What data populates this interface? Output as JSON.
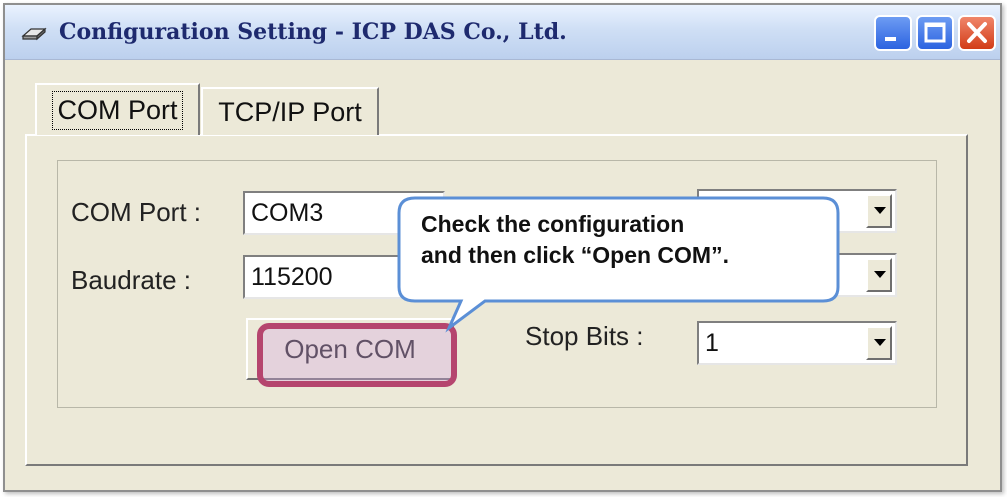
{
  "window": {
    "title": "Configuration Setting - ICP DAS Co., Ltd."
  },
  "tabs": [
    {
      "label": "COM Port",
      "selected": true
    },
    {
      "label": "TCP/IP Port",
      "selected": false
    }
  ],
  "form": {
    "com_port_label": "COM Port :",
    "com_port_value": "COM3",
    "baudrate_label": "Baudrate :",
    "baudrate_value": "115200",
    "stop_bits_label": "Stop Bits :",
    "stop_bits_value": "1",
    "open_button_label": "Open COM"
  },
  "callout": {
    "line1": "Check the configuration",
    "line2": "and then click “Open COM”."
  },
  "colors": {
    "highlight": "#b5456e",
    "callout_border": "#5b8fd6"
  }
}
